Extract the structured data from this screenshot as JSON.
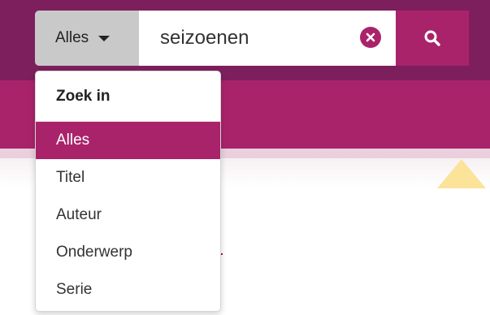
{
  "search": {
    "scope_label": "Alles",
    "query_value": "seizoenen",
    "clear_icon": "close-icon",
    "submit_icon": "search-icon"
  },
  "dropdown": {
    "header": "Zoek in",
    "items": [
      {
        "label": "Alles",
        "selected": true
      },
      {
        "label": "Titel",
        "selected": false
      },
      {
        "label": "Auteur",
        "selected": false
      },
      {
        "label": "Onderwerp",
        "selected": false
      },
      {
        "label": "Serie",
        "selected": false
      }
    ]
  },
  "colors": {
    "header_dark": "#7d1f5d",
    "brand_magenta": "#a9236b",
    "scope_gray": "#c9c9c9",
    "accent_yellow": "#fbe39a"
  }
}
